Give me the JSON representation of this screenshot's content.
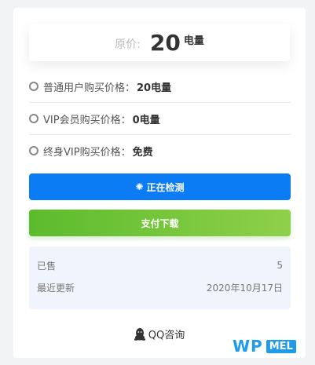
{
  "price": {
    "label": "原价:",
    "value": "20",
    "unit": "电量"
  },
  "rows": [
    {
      "label": "普通用户购买价格：",
      "value": "20电量"
    },
    {
      "label": "VIP会员购买价格：",
      "value": "0电量"
    },
    {
      "label": "终身VIP购买价格：",
      "value": "免费"
    }
  ],
  "buttons": {
    "checking": "正在检测",
    "pay": "支付下载"
  },
  "info": {
    "sold_label": "已售",
    "sold_value": "5",
    "updated_label": "最近更新",
    "updated_value": "2020年10月17日"
  },
  "qq": {
    "label": "QQ咨询"
  },
  "watermark": {
    "wp": "WP",
    "mel": "MEL"
  },
  "colors": {
    "primary": "#0b7cf4",
    "pay_green": "#6cc13a",
    "info_bg": "#f0f5fd",
    "wm_blue": "#1e9be9"
  }
}
